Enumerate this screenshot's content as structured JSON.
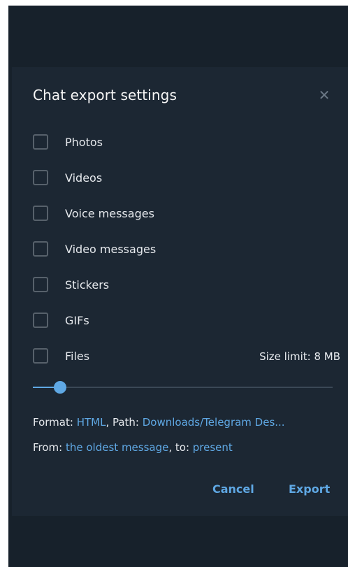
{
  "dialog": {
    "title": "Chat export settings",
    "close_icon": "close-icon"
  },
  "options": [
    {
      "label": "Photos",
      "checked": false
    },
    {
      "label": "Videos",
      "checked": false
    },
    {
      "label": "Voice messages",
      "checked": false
    },
    {
      "label": "Video messages",
      "checked": false
    },
    {
      "label": "Stickers",
      "checked": false
    },
    {
      "label": "GIFs",
      "checked": false
    },
    {
      "label": "Files",
      "checked": false
    }
  ],
  "size_limit": {
    "text": "Size limit: 8 MB",
    "slider_fraction": 0.09
  },
  "format": {
    "format_label": "Format: ",
    "format_value": "HTML",
    "path_label": ", Path: ",
    "path_value": "Downloads/Telegram Des..."
  },
  "range": {
    "from_label": "From: ",
    "from_value": "the oldest message",
    "to_label": ", to: ",
    "to_value": "present"
  },
  "buttons": {
    "cancel": "Cancel",
    "export": "Export"
  },
  "colors": {
    "window_bg": "#17212b",
    "dialog_bg": "#1c2733",
    "accent": "#5fa8e4",
    "checkbox_border": "#57616b",
    "text": "#e6e9ed"
  }
}
